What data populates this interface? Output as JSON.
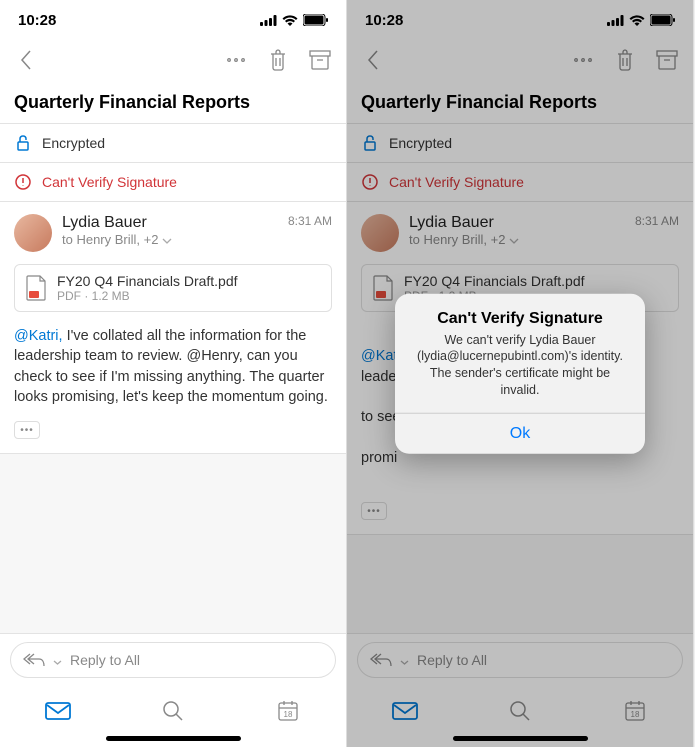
{
  "status": {
    "time": "10:28"
  },
  "subject": "Quarterly Financial Reports",
  "banners": {
    "encrypted_label": "Encrypted",
    "warn_label": "Can't Verify Signature"
  },
  "message": {
    "sender": "Lydia Bauer",
    "recipients_prefix": "to Henry Brill, +2",
    "time": "8:31 AM"
  },
  "attachment": {
    "name": "FY20 Q4 Financials Draft.pdf",
    "meta": "PDF · 1.2 MB"
  },
  "body": {
    "mention": "@Katri,",
    "text": " I've collated all the information for the leadership team to review. @Henry, can you check to see if I'm missing anything. The quarter looks promising, let's keep the momentum going."
  },
  "body_truncated": {
    "mention": "@Katr",
    "line2": "leader",
    "line3": "to see",
    "line4": "promi"
  },
  "reply": {
    "placeholder": "Reply to All"
  },
  "calendar_day": "18",
  "dialog": {
    "title": "Can't Verify Signature",
    "message": "We can't verify Lydia Bauer (lydia@lucernepubintl.com)'s identity. The sender's certificate might be invalid.",
    "ok": "Ok"
  }
}
